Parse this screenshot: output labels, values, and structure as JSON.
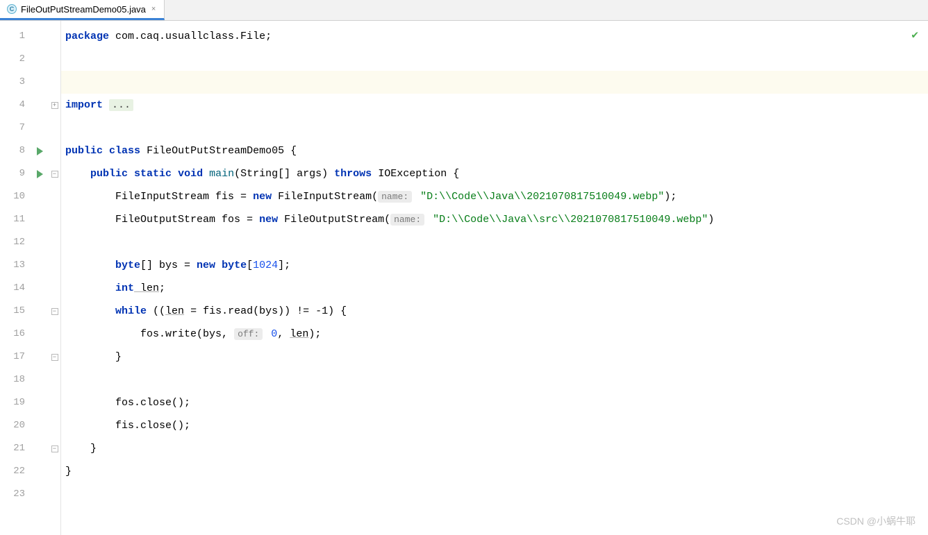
{
  "tab": {
    "filename": "FileOutPutStreamDemo05.java",
    "close": "×"
  },
  "gutter": {
    "lines": [
      "1",
      "2",
      "3",
      "4",
      "7",
      "8",
      "9",
      "10",
      "11",
      "12",
      "13",
      "14",
      "15",
      "16",
      "17",
      "18",
      "19",
      "20",
      "21",
      "22",
      "23"
    ]
  },
  "code": {
    "kw_package": "package",
    "pkg_path": "com.caq.usuallclass.File",
    "semicolon": ";",
    "kw_import": "import",
    "folded_ellipsis": "...",
    "kw_public": "public",
    "kw_class": "class",
    "class_name": "FileOutPutStreamDemo05",
    "lbrace": "{",
    "kw_static": "static",
    "kw_void": "void",
    "method_main": "main",
    "main_params": "(String[] args)",
    "kw_throws": "throws",
    "ioexception": "IOException",
    "fis_decl_a": "FileInputStream fis = ",
    "kw_new": "new",
    "fis_decl_b": " FileInputStream(",
    "hint_name1": "name:",
    "fis_path": "\"D:\\\\Code\\\\Java\\\\2021070817510049.webp\"",
    "close_paren_semi": ");",
    "fos_decl_a": "FileOutputStream fos = ",
    "fos_decl_b": " FileOutputStream(",
    "hint_name2": "name:",
    "fos_path": "\"D:\\\\Code\\\\Java\\\\src\\\\2021070817510049.webp\"",
    "close_paren": ")",
    "kw_byte": "byte",
    "bys_a": "[] bys = ",
    "bys_b": "[",
    "num_1024": "1024",
    "bys_c": "];",
    "kw_int": "int",
    "len_decl": " len",
    "kw_while": "while",
    "while_a": " ((",
    "len_var": "len",
    "while_b": " = fis.read(bys)) != -1) {",
    "write_a": "fos.write(bys, ",
    "hint_off": "off:",
    "num_0": "0",
    "write_b": ", ",
    "write_c": ");",
    "rbrace": "}",
    "fos_close": "fos.close();",
    "fis_close": "fis.close();"
  },
  "watermark": "CSDN @小蜗牛耶",
  "fold_plus": "+",
  "fold_minus": "−"
}
